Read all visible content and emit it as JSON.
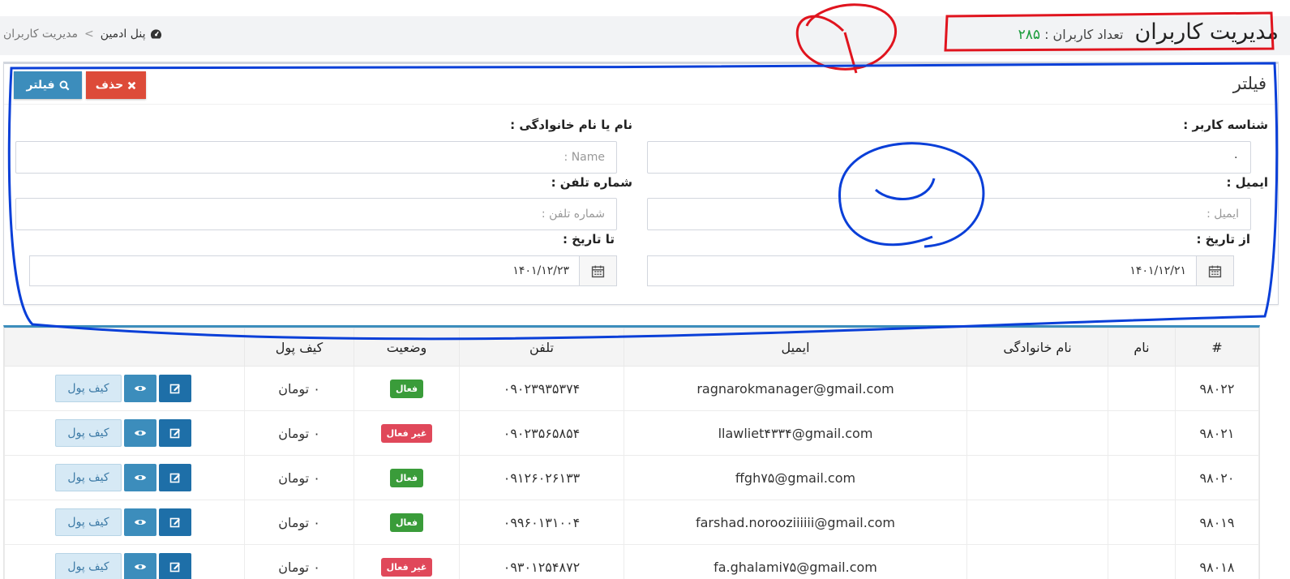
{
  "header": {
    "title": "مدیریت کاربران",
    "user_count_label": "تعداد کاربران :",
    "user_count": "۲۸۵"
  },
  "breadcrumb": {
    "home": "پنل ادمین",
    "separator": ">",
    "current": "مدیریت کاربران"
  },
  "filter": {
    "title": "فیلتر",
    "filter_button": "فیلتر",
    "delete_button": "حذف",
    "user_id_label": "شناسه کاربر :",
    "user_id_value": "۰",
    "name_label": "نام یا نام خانوادگی :",
    "name_placeholder": "Name :",
    "email_label": "ایمیل :",
    "email_placeholder": "ایمیل :",
    "phone_label": "شماره تلفن :",
    "phone_placeholder": "شماره تلفن :",
    "from_date_label": "از تاریخ :",
    "from_date_value": "۱۴۰۱/۱۲/۲۱",
    "to_date_label": "تا تاریخ :",
    "to_date_value": "۱۴۰۱/۱۲/۲۳"
  },
  "table": {
    "headers": [
      "#",
      "نام",
      "نام خانوادگی",
      "ایمیل",
      "تلفن",
      "وضعیت",
      "کیف پول",
      ""
    ],
    "wallet_button": "کیف پول",
    "rows": [
      {
        "id": "۹۸۰۲۲",
        "first": "",
        "last": "",
        "email": "ragnarokmanager@gmail.com",
        "phone": "۰۹۰۲۳۹۳۵۳۷۴",
        "status": "فعال",
        "active": true,
        "wallet": "۰ تومان"
      },
      {
        "id": "۹۸۰۲۱",
        "first": "",
        "last": "",
        "email": "llawliet۴۳۳۴@gmail.com",
        "phone": "۰۹۰۲۳۵۶۵۸۵۴",
        "status": "غیر فعال",
        "active": false,
        "wallet": "۰ تومان"
      },
      {
        "id": "۹۸۰۲۰",
        "first": "",
        "last": "",
        "email": "ffgh۷۵@gmail.com",
        "phone": "۰۹۱۲۶۰۲۶۱۳۳",
        "status": "فعال",
        "active": true,
        "wallet": "۰ تومان"
      },
      {
        "id": "۹۸۰۱۹",
        "first": "",
        "last": "",
        "email": "farshad.noroozi‌iiiii@gmail.com",
        "phone": "۰۹۹۶۰۱۳۱۰۰۴",
        "status": "فعال",
        "active": true,
        "wallet": "۰ تومان"
      },
      {
        "id": "۹۸۰۱۸",
        "first": "",
        "last": "",
        "email": "fa.ghalami۷۵@gmail.com",
        "phone": "۰۹۳۰۱۲۵۴۸۷۲",
        "status": "غیر فعال",
        "active": false,
        "wallet": "۰ تومان"
      }
    ]
  },
  "colors": {
    "primary": "#3c8dbc",
    "danger": "#dd4b39",
    "success": "#3a9c3a",
    "annotation_red": "#e0141e",
    "annotation_blue": "#0a3fd8"
  }
}
